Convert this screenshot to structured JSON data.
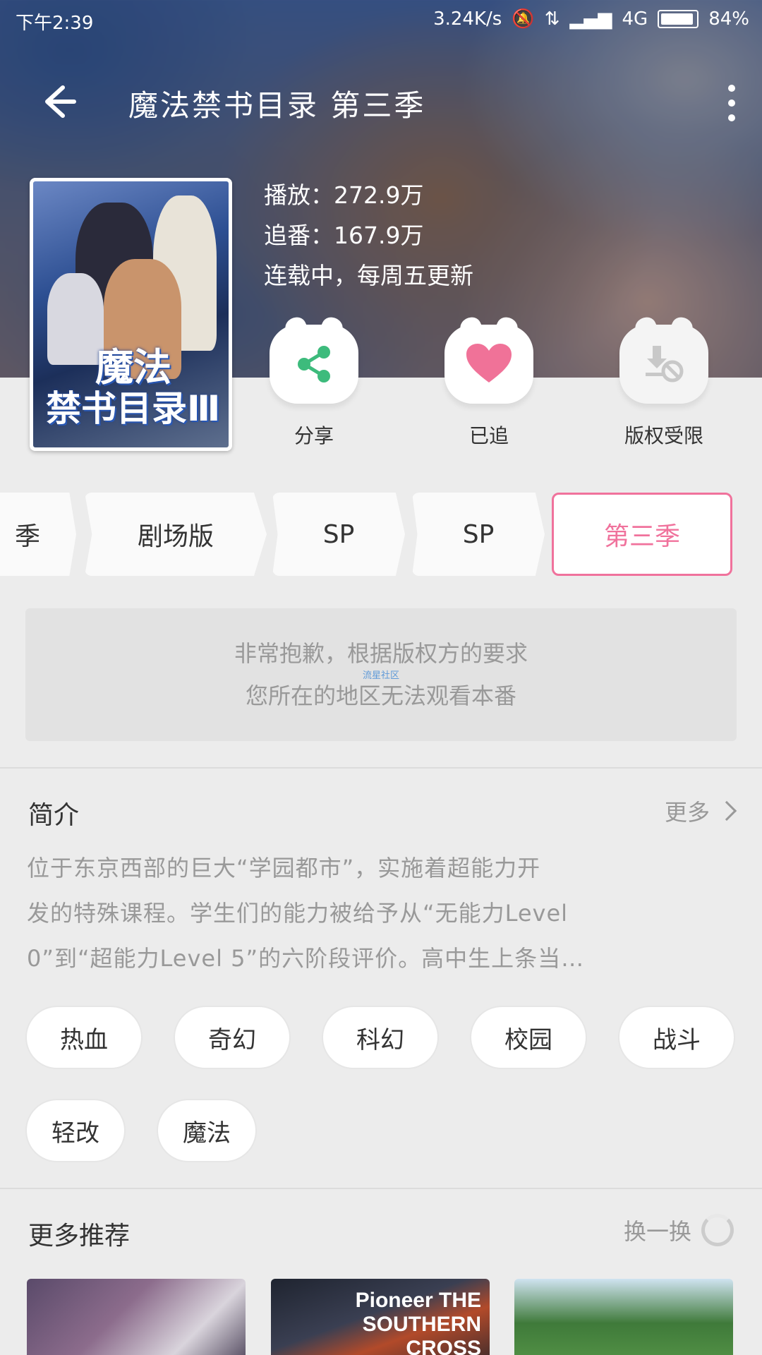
{
  "status_bar": {
    "time": "下午2:39",
    "speed": "3.24K/s",
    "network": "4G",
    "battery": "84%"
  },
  "header": {
    "title": "魔法禁书目录 第三季"
  },
  "cover": {
    "title_line1": "魔法",
    "title_line2": "禁书目录Ⅲ"
  },
  "stats": {
    "plays": "播放：272.9万",
    "follows": "追番：167.9万",
    "status": "连载中，每周五更新"
  },
  "actions": [
    {
      "label": "分享",
      "icon": "share-icon",
      "color": "#3dbb7c"
    },
    {
      "label": "已追",
      "icon": "heart-icon",
      "color": "#f07298"
    },
    {
      "label": "版权受限",
      "icon": "download-disabled-icon",
      "color": "#c8c8c8"
    }
  ],
  "seasons": [
    "季",
    "剧场版",
    "SP",
    "SP",
    "第三季"
  ],
  "notice": {
    "line1": "非常抱歉，根据版权方的要求",
    "line2": "您所在的地区无法观看本番",
    "watermark": "流星社区"
  },
  "intro": {
    "title": "简介",
    "more": "更多",
    "lines": [
      "位于东京西部的巨大“学园都市”，实施着超能力开",
      "发的特殊课程。学生们的能力被给予从“无能力Level",
      "0”到“超能力Level 5”的六阶段评价。高中生上条当…"
    ]
  },
  "tags": [
    "热血",
    "奇幻",
    "科幻",
    "校园",
    "战斗",
    "轻改",
    "魔法"
  ],
  "recommend": {
    "title": "更多推荐",
    "refresh": "换一换",
    "items": [
      {
        "overlay": ""
      },
      {
        "overlay": "Pioneer THE SOUTHERN CROSS"
      },
      {
        "overlay": ""
      }
    ]
  },
  "colors": {
    "accent": "#f0729c",
    "share": "#3dbb7c"
  }
}
